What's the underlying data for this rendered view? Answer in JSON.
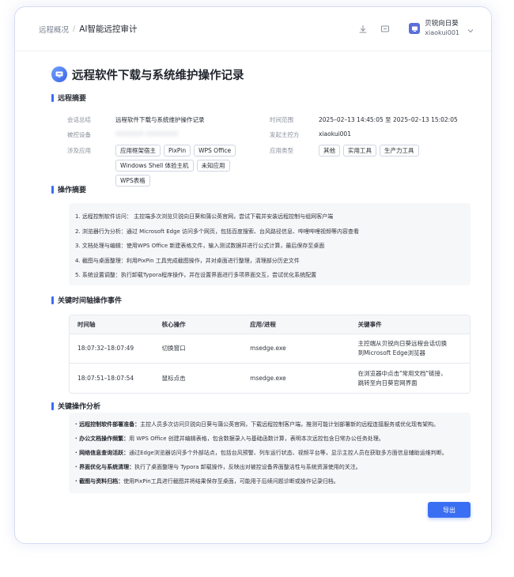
{
  "breadcrumb": {
    "parent": "远程概况",
    "current": "AI智能远控审计"
  },
  "user": {
    "name": "贝锐向日葵",
    "id": "xiaokui001"
  },
  "report": {
    "title": "远程软件下载与系统维护操作记录",
    "summary_section": {
      "title": "远程摘要",
      "session_label": "会话总结",
      "session_value": "远程软件下载与系统维护操作记录",
      "device_label": "被控设备",
      "device_value": "XXXXXXX XXXXXXXX",
      "apps_label": "涉及应用",
      "apps": [
        "应用框架宿主",
        "PixPin",
        "WPS Office",
        "Windows Shell 体验主机",
        "未知应用",
        "WPS表格"
      ],
      "time_label": "时间范围",
      "time_value": "2025–02–13 14:45:05 至 2025–02–13 15:02:05",
      "initiator_label": "发起主控方",
      "initiator_value": "xiaokui001",
      "app_type_label": "应用类型",
      "app_types": [
        "其他",
        "实用工具",
        "生产力工具"
      ]
    },
    "ops_section": {
      "title": "操作摘要",
      "items": [
        "1. 远程控制软件访问： 主控端多次浏览贝锐向日葵和蒲公英官网，尝试下载并安装远程控制与组网客户端",
        "2. 浏览器行为分析：通过 Microsoft Edge 访问多个网页，包括百度搜索、台风路径信息、哔哩哔哩视频等内容查看",
        "3. 文档处理与编辑：使用WPS Office 新建表格文件，输入测试数据并进行公式计算，最后保存至桌面",
        "4. 截图与桌面整理：利用PixPin 工具完成截图操作，并对桌面进行整理，清理部分历史文件",
        "5. 系统设置调整：执行卸载Typora程序操作，并在设置界面进行多项界面交互，尝试优化系统配置"
      ]
    },
    "timeline_section": {
      "title": "关键时间轴操作事件",
      "headers": [
        "时间轴",
        "核心操作",
        "应用/进程",
        "关键事件"
      ],
      "rows": [
        {
          "time": "18:07:32–18:07:49",
          "op": "切换窗口",
          "app": "msedge.exe",
          "event_1": "主控端从贝锐向日葵远程会话切换",
          "event_2": "到Microsoft Edge浏览器"
        },
        {
          "time": "18:07:51–18:07:54",
          "op": "鼠标点击",
          "app": "msedge.exe",
          "event_1": "在浏览器中点击\"常用文档\"链接，",
          "event_2": "跳转至向日葵官网界面"
        }
      ]
    },
    "analysis_section": {
      "title": "关键操作分析",
      "items": [
        {
          "label": "· 远程控制软件部署准备：",
          "text": "主控人员多次访问贝锐向日葵与蒲公英官网，下载远程控制客户端，推测可能计划部署新的远程连接服务或优化现有架构。"
        },
        {
          "label": "· 办公文档操作频繁：",
          "text": "用 WPS Office 创建并编辑表格，包含数据录入与基础函数计算，表明本次远控包含日常办公任务处理。"
        },
        {
          "label": "· 网络信息查询活跃：",
          "text": "通过Edge浏览器访问多个外部站点，包括台风预警、列车运行状态、视频平台等，显示主控人员在获取多方面信息辅助运维判断。"
        },
        {
          "label": "· 界面优化与系统清理：",
          "text": "执行了桌面整理与 Typora 卸载操作，反映出对被控设备界面整洁性与系统资源使用的关注。"
        },
        {
          "label": "· 截图与资料归档：",
          "text": "使用PixPin工具进行截图并将结果保存至桌面，可能用于后续问题诊断或操作记录归档。"
        }
      ]
    },
    "export_label": "导出"
  },
  "colors": {
    "accent": "#3b6ff3",
    "tag_border": "#cfd5e2",
    "box_bg": "#f6f7f9"
  },
  "icons": [
    "download-icon",
    "message-icon",
    "app-logo-icon",
    "chevron-down-icon",
    "report-icon"
  ]
}
